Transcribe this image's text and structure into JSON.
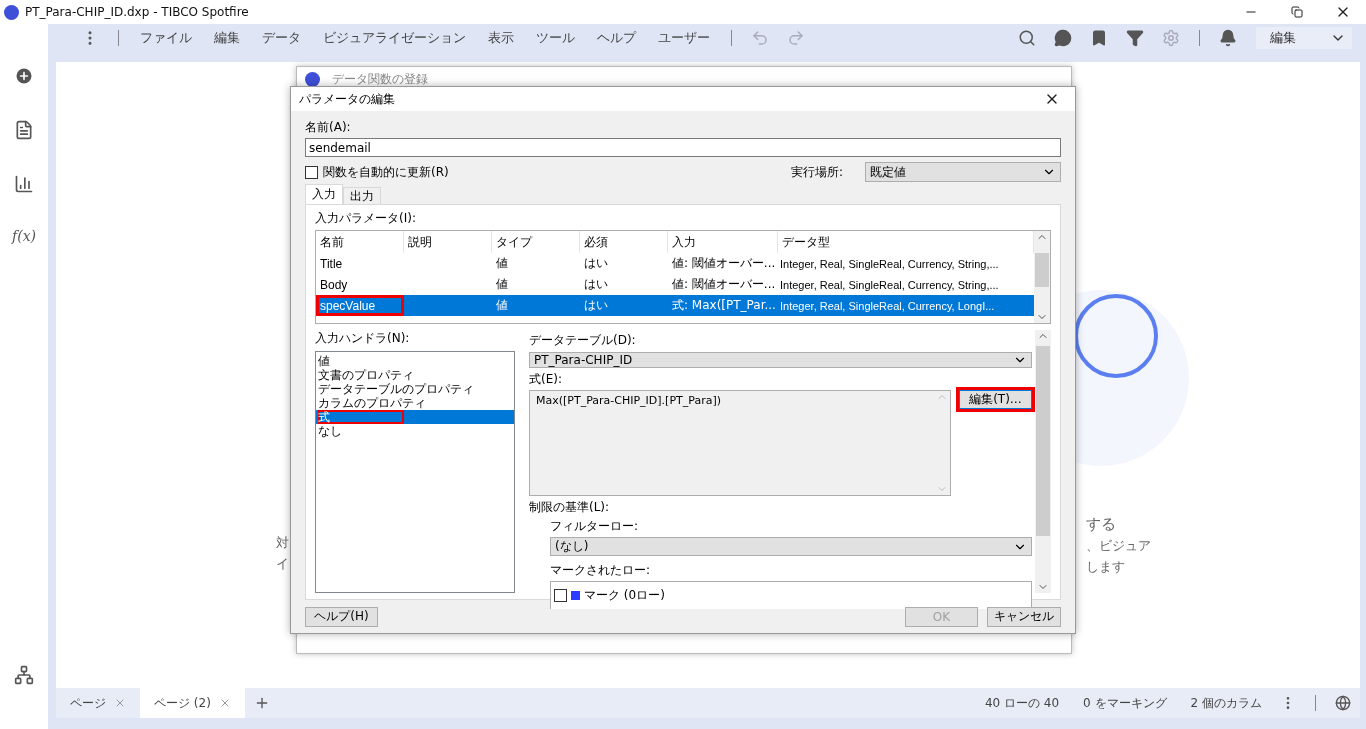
{
  "window": {
    "title": "PT_Para-CHIP_ID.dxp - TIBCO Spotfire"
  },
  "sidebar": {
    "formula_label": "f(x)"
  },
  "menu": [
    "ファイル",
    "編集",
    "データ",
    "ビジュアライゼーション",
    "表示",
    "ツール",
    "ヘルプ",
    "ユーザー"
  ],
  "mode_dropdown": {
    "value": "編集"
  },
  "canvas_hint": {
    "left": [
      "対",
      "イ"
    ],
    "right": [
      "する",
      "、ビジュア",
      "します"
    ]
  },
  "behind_dialog": {
    "title": "データ関数の登録"
  },
  "dialog": {
    "title": "パラメータの編集",
    "name_label": "名前(A):",
    "name_value": "sendemail",
    "auto_update": {
      "label": "関数を自動的に更新(R)",
      "checked": false
    },
    "run_location": {
      "label": "実行場所:",
      "value": "既定値"
    },
    "tabs": [
      {
        "label": "入力",
        "selected": true
      },
      {
        "label": "出力",
        "selected": false
      }
    ],
    "params_label": "入力パラメータ(I):",
    "columns": [
      "名前",
      "説明",
      "タイプ",
      "必須",
      "入力",
      "データ型"
    ],
    "rows": [
      {
        "name": "Title",
        "type": "値",
        "required": "はい",
        "input": "値: 閾値オーバー...",
        "data_type": "Integer, Real, SingleReal, Currency, String,...",
        "selected": false,
        "highlighted": false
      },
      {
        "name": "Body",
        "type": "値",
        "required": "はい",
        "input": "値: 閾値オーバー...",
        "data_type": "Integer, Real, SingleReal, Currency, String,...",
        "selected": false,
        "highlighted": false
      },
      {
        "name": "specValue",
        "type": "値",
        "required": "はい",
        "input": "式: Max([PT_Par...",
        "data_type": "Integer, Real, SingleReal, Currency, LongI...",
        "selected": true,
        "highlighted": true
      }
    ],
    "handlers_label": "入力ハンドラ(N):",
    "handlers": [
      {
        "label": "値",
        "selected": false,
        "highlighted": false
      },
      {
        "label": "文書のプロパティ",
        "selected": false,
        "highlighted": false
      },
      {
        "label": "データテーブルのプロパティ",
        "selected": false,
        "highlighted": false
      },
      {
        "label": "カラムのプロパティ",
        "selected": false,
        "highlighted": false
      },
      {
        "label": "式",
        "selected": true,
        "highlighted": true
      },
      {
        "label": "なし",
        "selected": false,
        "highlighted": false
      }
    ],
    "data_table": {
      "label": "データテーブル(D):",
      "value": "PT_Para-CHIP_ID"
    },
    "expression": {
      "label": "式(E):",
      "value": "Max([PT_Para-CHIP_ID].[PT_Para])",
      "edit_button": "編集(T)…",
      "edit_highlighted": true
    },
    "limit": {
      "label": "制限の基準(L):",
      "filter_label": "フィルターロー:",
      "filter_value": "(なし)",
      "marked_label": "マークされたロー:",
      "markings": [
        {
          "label": "マーク (0ロー)",
          "checked": false,
          "color": "#2b3bff"
        }
      ]
    },
    "help_button": "ヘルプ(H)",
    "ok_button": {
      "label": "OK",
      "disabled": true
    },
    "cancel_button": "キャンセル"
  },
  "page_tabs": [
    {
      "label": "ページ",
      "selected": false
    },
    {
      "label": "ページ (2)",
      "selected": true
    }
  ],
  "status": [
    "40 ローの 40",
    "0 をマーキング",
    "2 個のカラム"
  ]
}
